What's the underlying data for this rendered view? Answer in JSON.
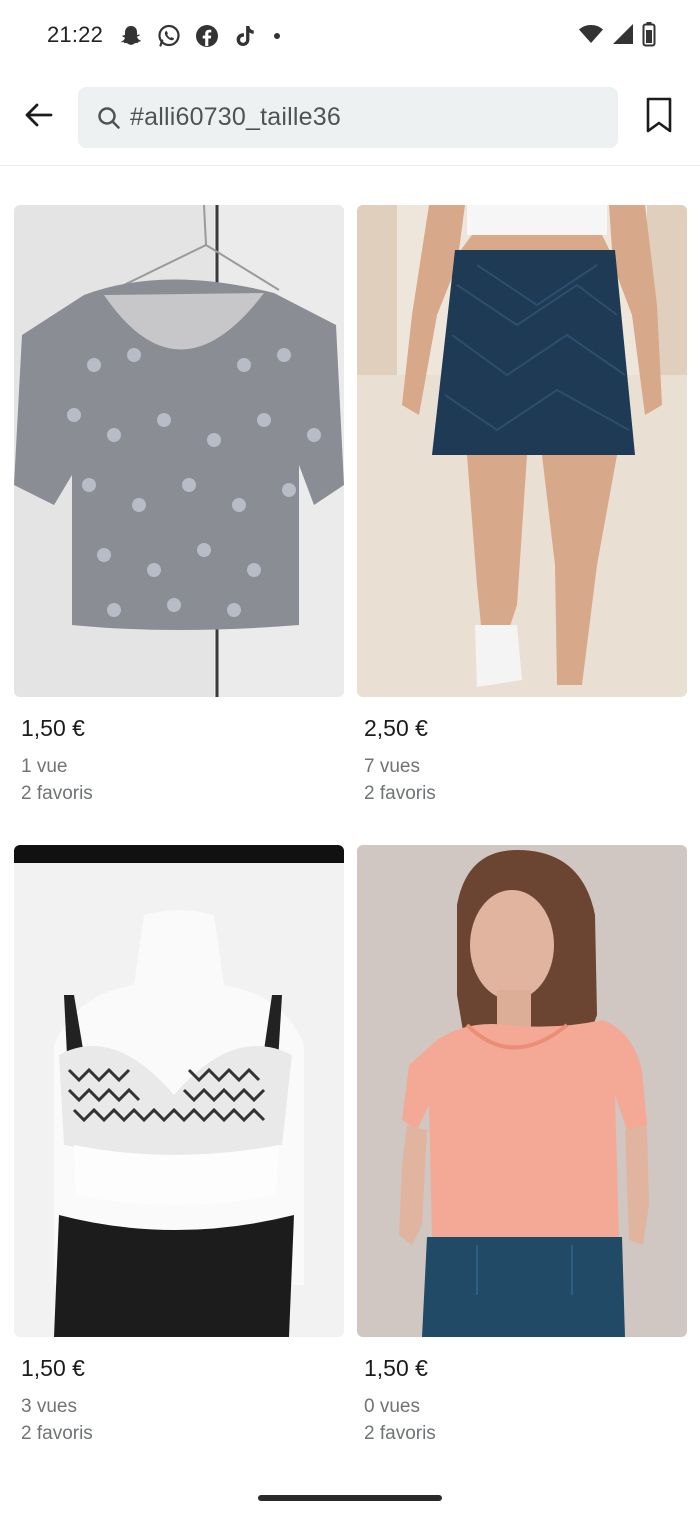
{
  "status_bar": {
    "time": "21:22",
    "app_icons": [
      "snapchat-icon",
      "whatsapp-icon",
      "facebook-icon",
      "tiktok-icon",
      "dot-icon"
    ],
    "system_icons": [
      "wifi-icon",
      "signal-icon",
      "battery-icon"
    ]
  },
  "header": {
    "back_icon": "arrow-left-icon",
    "search_query": "#alli60730_taille36",
    "search_icon": "search-icon",
    "bookmark_icon": "bookmark-icon"
  },
  "items": [
    {
      "price": "1,50 €",
      "views": "1 vue",
      "favorites": "2 favoris"
    },
    {
      "price": "2,50 €",
      "views": "7 vues",
      "favorites": "2 favoris"
    },
    {
      "price": "1,50 €",
      "views": "3 vues",
      "favorites": "2 favoris"
    },
    {
      "price": "1,50 €",
      "views": "0 vues",
      "favorites": "2 favoris"
    }
  ],
  "colors": {
    "search_bg": "#eef1f2",
    "text_primary": "#1c1c1c",
    "text_secondary": "#6f7375"
  }
}
